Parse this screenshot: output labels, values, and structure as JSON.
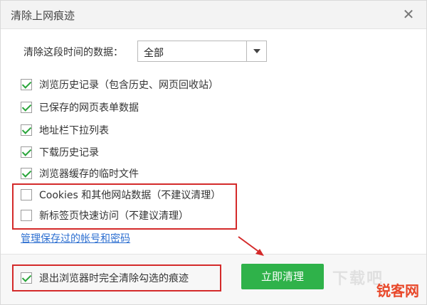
{
  "dialog": {
    "title": "清除上网痕迹",
    "close_glyph": "✕"
  },
  "range": {
    "label": "清除这段时间的数据：",
    "selected": "全部"
  },
  "options": [
    {
      "label": "浏览历史记录（包含历史、网页回收站）",
      "checked": true
    },
    {
      "label": "已保存的网页表单数据",
      "checked": true
    },
    {
      "label": "地址栏下拉列表",
      "checked": true
    },
    {
      "label": "下载历史记录",
      "checked": true
    },
    {
      "label": "浏览器缓存的临时文件",
      "checked": true
    },
    {
      "label": "Cookies 和其他网站数据（不建议清理）",
      "checked": false
    },
    {
      "label": "新标签页快速访问（不建议清理）",
      "checked": false
    }
  ],
  "manage_link": "管理保存过的帐号和密码",
  "footer": {
    "exit_clear_label": "退出浏览器时完全清除勾选的痕迹",
    "exit_clear_checked": true,
    "clear_button": "立即清理"
  },
  "watermark": {
    "text": "下载吧",
    "logo": "锐客网"
  },
  "colors": {
    "accent_green": "#2fb24a",
    "annotation_red": "#d42a2a",
    "link_blue": "#2d6fd1"
  }
}
